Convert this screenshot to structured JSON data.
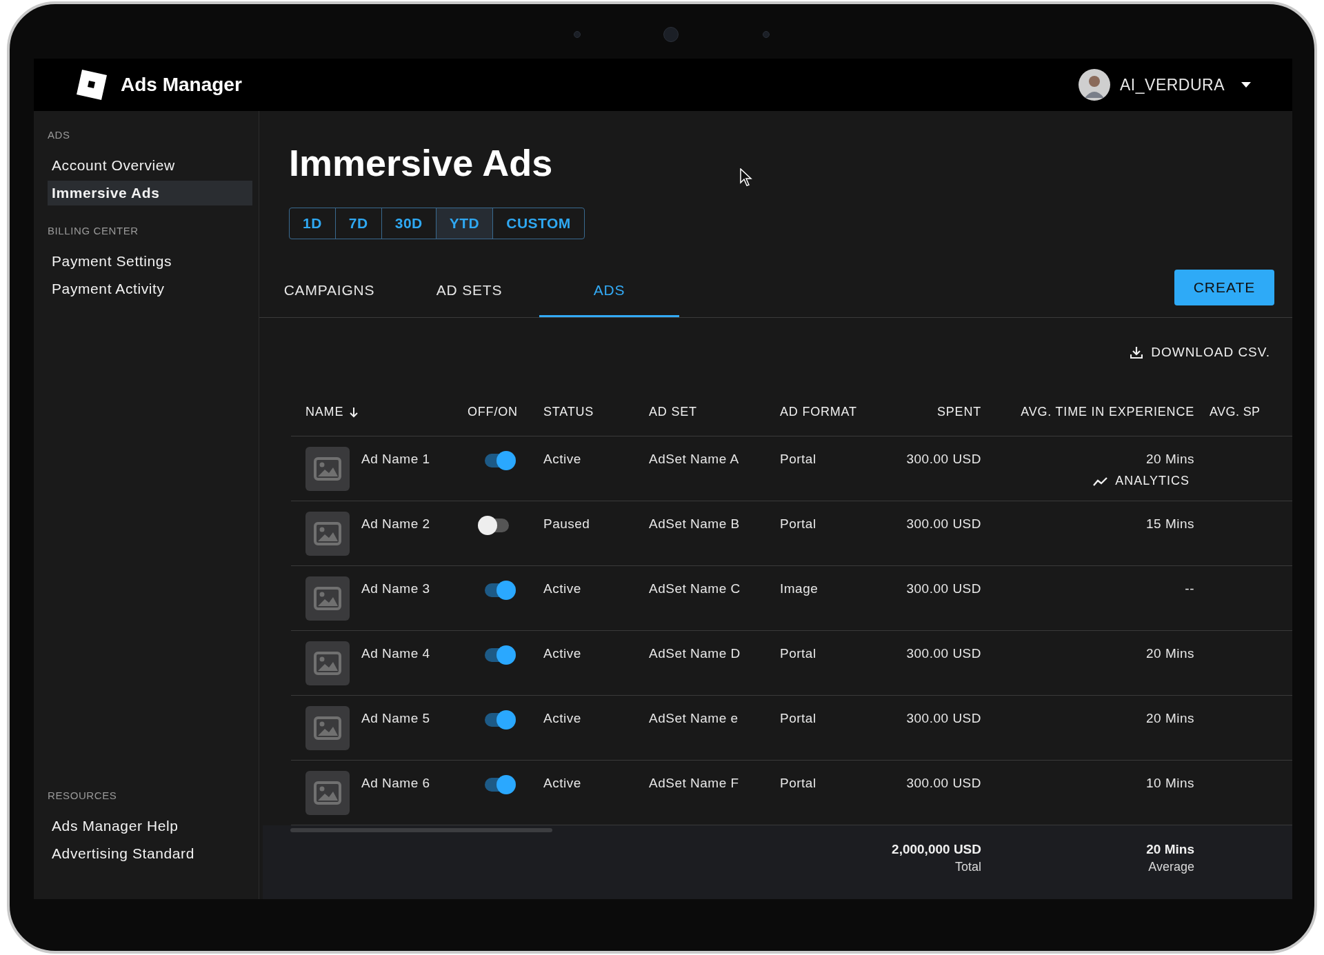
{
  "header": {
    "app_title": "Ads Manager",
    "user": "AI_VERDURA"
  },
  "sidebar": {
    "sections": [
      {
        "heading": "ADS",
        "items": [
          {
            "label": "Account Overview",
            "selected": false
          },
          {
            "label": "Immersive Ads",
            "selected": true
          }
        ]
      },
      {
        "heading": "BILLING CENTER",
        "items": [
          {
            "label": "Payment Settings",
            "selected": false
          },
          {
            "label": "Payment Activity",
            "selected": false
          }
        ]
      }
    ],
    "bottom_sections": [
      {
        "heading": "RESOURCES",
        "items": [
          {
            "label": "Ads Manager Help",
            "selected": false
          },
          {
            "label": "Advertising Standard",
            "selected": false
          }
        ]
      }
    ]
  },
  "page": {
    "title": "Immersive Ads",
    "ranges": [
      {
        "label": "1D",
        "selected": false
      },
      {
        "label": "7D",
        "selected": false
      },
      {
        "label": "30D",
        "selected": false
      },
      {
        "label": "YTD",
        "selected": true
      },
      {
        "label": "CUSTOM",
        "selected": false
      }
    ],
    "tabs": [
      {
        "label": "CAMPAIGNS",
        "selected": false
      },
      {
        "label": "AD SETS",
        "selected": false
      },
      {
        "label": "ADS",
        "selected": true
      }
    ],
    "create_button": "CREATE",
    "download": "DOWNLOAD CSV."
  },
  "table": {
    "columns": [
      {
        "label": "NAME",
        "sorted": true
      },
      {
        "label": "OFF/ON",
        "sorted": false
      },
      {
        "label": "STATUS",
        "sorted": false
      },
      {
        "label": "AD SET",
        "sorted": false
      },
      {
        "label": "AD FORMAT",
        "sorted": false
      },
      {
        "label": "SPENT",
        "sorted": false
      },
      {
        "label": "AVG. TIME IN EXPERIENCE",
        "sorted": false
      },
      {
        "label": "AVG. SP",
        "sorted": false
      }
    ],
    "rows": [
      {
        "name": "Ad Name 1",
        "on": true,
        "status": "Active",
        "ad_set": "AdSet Name A",
        "format": "Portal",
        "spent": "300.00 USD",
        "avg_time": "20 Mins",
        "action": "ANALYTICS"
      },
      {
        "name": "Ad Name 2",
        "on": false,
        "status": "Paused",
        "ad_set": "AdSet Name B",
        "format": "Portal",
        "spent": "300.00 USD",
        "avg_time": "15 Mins"
      },
      {
        "name": "Ad Name 3",
        "on": true,
        "status": "Active",
        "ad_set": "AdSet Name C",
        "format": "Image",
        "spent": "300.00 USD",
        "avg_time": "--"
      },
      {
        "name": "Ad Name 4",
        "on": true,
        "status": "Active",
        "ad_set": "AdSet Name D",
        "format": "Portal",
        "spent": "300.00 USD",
        "avg_time": "20 Mins"
      },
      {
        "name": "Ad Name 5",
        "on": true,
        "status": "Active",
        "ad_set": "AdSet Name e",
        "format": "Portal",
        "spent": "300.00 USD",
        "avg_time": "20 Mins"
      },
      {
        "name": "Ad Name 6",
        "on": true,
        "status": "Active",
        "ad_set": "AdSet Name F",
        "format": "Portal",
        "spent": "300.00 USD",
        "avg_time": "10 Mins"
      }
    ],
    "totals": {
      "spent": "2,000,000 USD",
      "spent_label": "Total",
      "avg_time": "20 Mins",
      "avg_time_label": "Average"
    }
  }
}
